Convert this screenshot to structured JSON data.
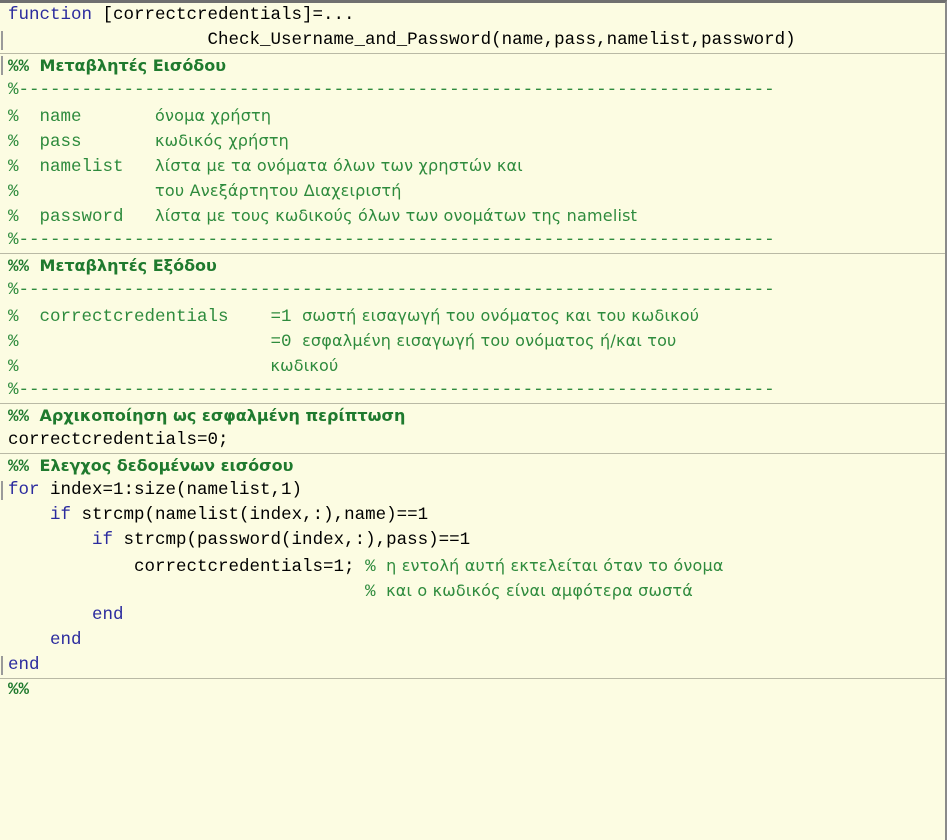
{
  "editor": {
    "language": "MATLAB",
    "background_color": "#fcfce2",
    "comment_color": "#2e8b3d",
    "keyword_color": "#2b2b9e",
    "text_color": "#000000",
    "cell_divider_color": "#b9b9a5"
  },
  "lines": [
    {
      "n": 1,
      "fold": false,
      "cell_start": false,
      "segments": [
        {
          "cls": "kw",
          "text": "function"
        },
        {
          "cls": "plain",
          "text": " [correctcredentials]=..."
        }
      ]
    },
    {
      "n": 2,
      "fold": true,
      "cell_start": false,
      "segments": [
        {
          "cls": "plain",
          "text": "                   Check_Username_and_Password(name,pass,namelist,password)"
        }
      ]
    },
    {
      "n": 3,
      "fold": true,
      "cell_start": true,
      "segments": [
        {
          "cls": "cell-mono",
          "text": "%% "
        },
        {
          "cls": "cell",
          "text": "Μεταβλητές Εισόδου"
        }
      ]
    },
    {
      "n": 4,
      "fold": false,
      "cell_start": false,
      "segments": [
        {
          "cls": "cmt-mono",
          "text": "%------------------------------------------------------------------------"
        }
      ]
    },
    {
      "n": 5,
      "fold": false,
      "cell_start": false,
      "segments": [
        {
          "cls": "cmt-mono",
          "text": "%  name       "
        },
        {
          "cls": "cmt",
          "text": "όνομα χρήστη"
        }
      ]
    },
    {
      "n": 6,
      "fold": false,
      "cell_start": false,
      "segments": [
        {
          "cls": "cmt-mono",
          "text": "%  pass       "
        },
        {
          "cls": "cmt",
          "text": "κωδικός χρήστη"
        }
      ]
    },
    {
      "n": 7,
      "fold": false,
      "cell_start": false,
      "segments": [
        {
          "cls": "cmt-mono",
          "text": "%  namelist   "
        },
        {
          "cls": "cmt",
          "text": "λίστα με τα ονόματα όλων των χρηστών και"
        }
      ]
    },
    {
      "n": 8,
      "fold": false,
      "cell_start": false,
      "segments": [
        {
          "cls": "cmt-mono",
          "text": "%             "
        },
        {
          "cls": "cmt",
          "text": "του Ανεξάρτητου Διαχειριστή"
        }
      ]
    },
    {
      "n": 9,
      "fold": false,
      "cell_start": false,
      "segments": [
        {
          "cls": "cmt-mono",
          "text": "%  password   "
        },
        {
          "cls": "cmt",
          "text": "λίστα με τους κωδικούς όλων των ονομάτων της namelist"
        }
      ]
    },
    {
      "n": 10,
      "fold": false,
      "cell_start": false,
      "segments": [
        {
          "cls": "cmt-mono",
          "text": "%------------------------------------------------------------------------"
        }
      ]
    },
    {
      "n": 11,
      "fold": false,
      "cell_start": true,
      "segments": [
        {
          "cls": "cell-mono",
          "text": "%% "
        },
        {
          "cls": "cell",
          "text": "Μεταβλητές Εξόδου"
        }
      ]
    },
    {
      "n": 12,
      "fold": false,
      "cell_start": false,
      "segments": [
        {
          "cls": "cmt-mono",
          "text": "%------------------------------------------------------------------------"
        }
      ]
    },
    {
      "n": 13,
      "fold": false,
      "cell_start": false,
      "segments": [
        {
          "cls": "cmt-mono",
          "text": "%  correctcredentials    =1 "
        },
        {
          "cls": "cmt",
          "text": "σωστή εισαγωγή του ονόματος και του κωδικού"
        }
      ]
    },
    {
      "n": 14,
      "fold": false,
      "cell_start": false,
      "segments": [
        {
          "cls": "cmt-mono",
          "text": "%                        =0 "
        },
        {
          "cls": "cmt",
          "text": "εσφαλμένη εισαγωγή του ονόματος ή/και του"
        }
      ]
    },
    {
      "n": 15,
      "fold": false,
      "cell_start": false,
      "segments": [
        {
          "cls": "cmt-mono",
          "text": "%                        "
        },
        {
          "cls": "cmt",
          "text": "κωδικού"
        }
      ]
    },
    {
      "n": 16,
      "fold": false,
      "cell_start": false,
      "segments": [
        {
          "cls": "cmt-mono",
          "text": "%------------------------------------------------------------------------"
        }
      ]
    },
    {
      "n": 17,
      "fold": false,
      "cell_start": true,
      "segments": [
        {
          "cls": "cell-mono",
          "text": "%% "
        },
        {
          "cls": "cell",
          "text": "Αρχικοποίηση ως εσφαλμένη περίπτωση"
        }
      ]
    },
    {
      "n": 18,
      "fold": false,
      "cell_start": false,
      "segments": [
        {
          "cls": "plain",
          "text": "correctcredentials=0;"
        }
      ]
    },
    {
      "n": 19,
      "fold": false,
      "cell_start": true,
      "segments": [
        {
          "cls": "cell-mono",
          "text": "%% "
        },
        {
          "cls": "cell",
          "text": "Ελεγχος δεδομένων εισόσου"
        }
      ]
    },
    {
      "n": 20,
      "fold": true,
      "cell_start": false,
      "segments": [
        {
          "cls": "kw",
          "text": "for"
        },
        {
          "cls": "plain",
          "text": " index=1:size(namelist,1)"
        }
      ]
    },
    {
      "n": 21,
      "fold": false,
      "cell_start": false,
      "segments": [
        {
          "cls": "plain",
          "text": "    "
        },
        {
          "cls": "kw",
          "text": "if"
        },
        {
          "cls": "plain",
          "text": " strcmp(namelist(index,:),name)==1"
        }
      ]
    },
    {
      "n": 22,
      "fold": false,
      "cell_start": false,
      "segments": [
        {
          "cls": "plain",
          "text": "        "
        },
        {
          "cls": "kw",
          "text": "if"
        },
        {
          "cls": "plain",
          "text": " strcmp(password(index,:),pass)==1"
        }
      ]
    },
    {
      "n": 23,
      "fold": false,
      "cell_start": false,
      "segments": [
        {
          "cls": "plain",
          "text": "            correctcredentials=1; "
        },
        {
          "cls": "cmt-mono",
          "text": "% "
        },
        {
          "cls": "cmt",
          "text": "η εντολή αυτή εκτελείται όταν το όνομα"
        }
      ]
    },
    {
      "n": 24,
      "fold": false,
      "cell_start": false,
      "segments": [
        {
          "cls": "cmt-mono",
          "text": "                                  % "
        },
        {
          "cls": "cmt",
          "text": "και ο κωδικός είναι αμφότερα σωστά"
        }
      ]
    },
    {
      "n": 25,
      "fold": false,
      "cell_start": false,
      "segments": [
        {
          "cls": "plain",
          "text": "        "
        },
        {
          "cls": "kw",
          "text": "end"
        }
      ]
    },
    {
      "n": 26,
      "fold": false,
      "cell_start": false,
      "segments": [
        {
          "cls": "plain",
          "text": "    "
        },
        {
          "cls": "kw",
          "text": "end"
        }
      ]
    },
    {
      "n": 27,
      "fold": true,
      "cell_start": false,
      "segments": [
        {
          "cls": "kw",
          "text": "end"
        }
      ]
    },
    {
      "n": 28,
      "fold": false,
      "cell_start": true,
      "segments": [
        {
          "cls": "cell-mono",
          "text": "%%"
        }
      ]
    }
  ]
}
